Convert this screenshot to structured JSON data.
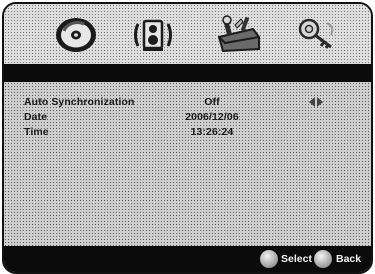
{
  "menu": {
    "icons": [
      {
        "name": "disc-icon"
      },
      {
        "name": "speaker-icon"
      },
      {
        "name": "toolbox-icon"
      },
      {
        "name": "key-icon"
      }
    ]
  },
  "settings": [
    {
      "label": "Auto Synchronization",
      "value": "Off"
    },
    {
      "label": "Date",
      "value": "2006/12/06"
    },
    {
      "label": "Time",
      "value": "13:26:24"
    }
  ],
  "footer": {
    "select_label": "Select",
    "back_label": "Back"
  }
}
